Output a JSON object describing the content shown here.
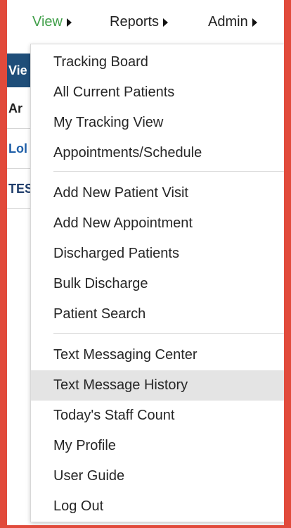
{
  "nav": {
    "view": "View",
    "reports": "Reports",
    "admin": "Admin"
  },
  "background": {
    "header_label": "Vie",
    "rows": [
      "Ar",
      "Lol",
      "TES"
    ]
  },
  "menu": {
    "group1": [
      "Tracking Board",
      "All Current Patients",
      "My Tracking View",
      "Appointments/Schedule"
    ],
    "group2": [
      "Add New Patient Visit",
      "Add New Appointment",
      "Discharged Patients",
      "Bulk Discharge",
      "Patient Search"
    ],
    "group3": [
      "Text Messaging Center",
      "Text Message History",
      "Today's Staff Count",
      "My Profile",
      "User Guide",
      "Log Out"
    ],
    "highlighted": "Text Message History"
  },
  "colors": {
    "frame_border": "#e14a3b",
    "nav_active": "#3f9e48",
    "header_bg": "#1f4e79",
    "highlight_bg": "#e4e4e4"
  }
}
